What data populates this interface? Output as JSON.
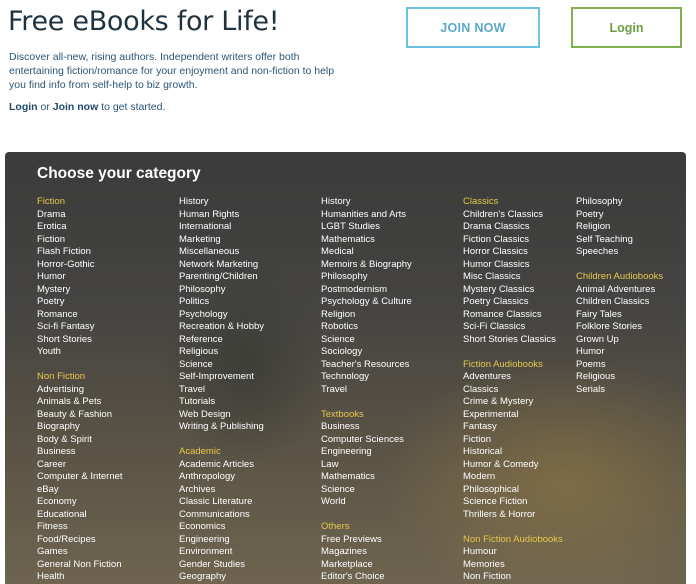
{
  "header": {
    "title": "Free eBooks for Life!",
    "intro": "Discover all-new, rising authors. Independent writers offer both entertaining fiction/romance for your enjoyment and non-fiction to help you find info from self-help to biz growth.",
    "cta_login": "Login",
    "cta_or": " or ",
    "cta_join": "Join now",
    "cta_rest": " to get started.",
    "join_button": "JOIN NOW",
    "login_button": "Login"
  },
  "colors": {
    "join_border": "#6cc0e3",
    "login_border": "#7fb24f",
    "heading_accent": "#e6c84a"
  },
  "categories": {
    "title": "Choose your category",
    "columns": [
      [
        {
          "type": "head",
          "label": "Fiction"
        },
        {
          "type": "item",
          "label": "Drama"
        },
        {
          "type": "item",
          "label": "Erotica"
        },
        {
          "type": "item",
          "label": "Fiction"
        },
        {
          "type": "item",
          "label": "Flash Fiction"
        },
        {
          "type": "item",
          "label": "Horror-Gothic"
        },
        {
          "type": "item",
          "label": "Humor"
        },
        {
          "type": "item",
          "label": "Mystery"
        },
        {
          "type": "item",
          "label": "Poetry"
        },
        {
          "type": "item",
          "label": "Romance"
        },
        {
          "type": "item",
          "label": "Sci-fi Fantasy"
        },
        {
          "type": "item",
          "label": "Short Stories"
        },
        {
          "type": "item",
          "label": "Youth"
        },
        {
          "type": "gap"
        },
        {
          "type": "head",
          "label": "Non Fiction"
        },
        {
          "type": "item",
          "label": "Advertising"
        },
        {
          "type": "item",
          "label": "Animals & Pets"
        },
        {
          "type": "item",
          "label": "Beauty & Fashion"
        },
        {
          "type": "item",
          "label": "Biography"
        },
        {
          "type": "item",
          "label": "Body & Spirit"
        },
        {
          "type": "item",
          "label": "Business"
        },
        {
          "type": "item",
          "label": "Career"
        },
        {
          "type": "item",
          "label": "Computer & Internet"
        },
        {
          "type": "item",
          "label": "eBay"
        },
        {
          "type": "item",
          "label": "Economy"
        },
        {
          "type": "item",
          "label": "Educational"
        },
        {
          "type": "item",
          "label": "Fitness"
        },
        {
          "type": "item",
          "label": "Food/Recipes"
        },
        {
          "type": "item",
          "label": "Games"
        },
        {
          "type": "item",
          "label": "General Non Fiction"
        },
        {
          "type": "item",
          "label": "Health"
        }
      ],
      [
        {
          "type": "item",
          "label": "History"
        },
        {
          "type": "item",
          "label": "Human Rights"
        },
        {
          "type": "item",
          "label": "International"
        },
        {
          "type": "item",
          "label": "Marketing"
        },
        {
          "type": "item",
          "label": "Miscellaneous"
        },
        {
          "type": "item",
          "label": "Network Marketing"
        },
        {
          "type": "item",
          "label": "Parenting/Children"
        },
        {
          "type": "item",
          "label": "Philosophy"
        },
        {
          "type": "item",
          "label": "Politics"
        },
        {
          "type": "item",
          "label": "Psychology"
        },
        {
          "type": "item",
          "label": "Recreation & Hobby"
        },
        {
          "type": "item",
          "label": "Reference"
        },
        {
          "type": "item",
          "label": "Religious"
        },
        {
          "type": "item",
          "label": "Science"
        },
        {
          "type": "item",
          "label": "Self-Improvement"
        },
        {
          "type": "item",
          "label": "Travel"
        },
        {
          "type": "item",
          "label": "Tutorials"
        },
        {
          "type": "item",
          "label": "Web Design"
        },
        {
          "type": "item",
          "label": "Writing & Publishing"
        },
        {
          "type": "gap"
        },
        {
          "type": "head",
          "label": "Academic"
        },
        {
          "type": "item",
          "label": "Academic Articles"
        },
        {
          "type": "item",
          "label": "Anthropology"
        },
        {
          "type": "item",
          "label": "Archives"
        },
        {
          "type": "item",
          "label": "Classic Literature"
        },
        {
          "type": "item",
          "label": "Communications"
        },
        {
          "type": "item",
          "label": "Economics"
        },
        {
          "type": "item",
          "label": "Engineering"
        },
        {
          "type": "item",
          "label": "Environment"
        },
        {
          "type": "item",
          "label": "Gender Studies"
        },
        {
          "type": "item",
          "label": "Geography"
        }
      ],
      [
        {
          "type": "item",
          "label": "History"
        },
        {
          "type": "item",
          "label": "Humanities and Arts"
        },
        {
          "type": "item",
          "label": "LGBT Studies"
        },
        {
          "type": "item",
          "label": "Mathematics"
        },
        {
          "type": "item",
          "label": "Medical"
        },
        {
          "type": "item",
          "label": "Memoirs & Biography"
        },
        {
          "type": "item",
          "label": "Philosophy"
        },
        {
          "type": "item",
          "label": "Postmodernism"
        },
        {
          "type": "item",
          "label": "Psychology & Culture"
        },
        {
          "type": "item",
          "label": "Religion"
        },
        {
          "type": "item",
          "label": "Robotics"
        },
        {
          "type": "item",
          "label": "Science"
        },
        {
          "type": "item",
          "label": "Sociology"
        },
        {
          "type": "item",
          "label": "Teacher's Resources"
        },
        {
          "type": "item",
          "label": "Technology"
        },
        {
          "type": "item",
          "label": "Travel"
        },
        {
          "type": "gap"
        },
        {
          "type": "head",
          "label": "Textbooks"
        },
        {
          "type": "item",
          "label": "Business"
        },
        {
          "type": "item",
          "label": "Computer Sciences"
        },
        {
          "type": "item",
          "label": "Engineering"
        },
        {
          "type": "item",
          "label": "Law"
        },
        {
          "type": "item",
          "label": "Mathematics"
        },
        {
          "type": "item",
          "label": "Science"
        },
        {
          "type": "item",
          "label": "World"
        },
        {
          "type": "gap"
        },
        {
          "type": "head",
          "label": "Others"
        },
        {
          "type": "item",
          "label": "Free Previews"
        },
        {
          "type": "item",
          "label": "Magazines"
        },
        {
          "type": "item",
          "label": "Marketplace"
        },
        {
          "type": "item",
          "label": "Editor's Choice"
        }
      ],
      [
        {
          "type": "head",
          "label": "Classics"
        },
        {
          "type": "item",
          "label": "Children's Classics"
        },
        {
          "type": "item",
          "label": "Drama Classics"
        },
        {
          "type": "item",
          "label": "Fiction Classics"
        },
        {
          "type": "item",
          "label": "Horror Classics"
        },
        {
          "type": "item",
          "label": "Humor Classics"
        },
        {
          "type": "item",
          "label": "Misc Classics"
        },
        {
          "type": "item",
          "label": "Mystery Classics"
        },
        {
          "type": "item",
          "label": "Poetry Classics"
        },
        {
          "type": "item",
          "label": "Romance Classics"
        },
        {
          "type": "item",
          "label": "Sci-Fi Classics"
        },
        {
          "type": "item",
          "label": "Short Stories Classics"
        },
        {
          "type": "gap"
        },
        {
          "type": "head",
          "label": "Fiction Audiobooks"
        },
        {
          "type": "item",
          "label": "Adventures"
        },
        {
          "type": "item",
          "label": "Classics"
        },
        {
          "type": "item",
          "label": "Crime & Mystery"
        },
        {
          "type": "item",
          "label": "Experimental"
        },
        {
          "type": "item",
          "label": "Fantasy"
        },
        {
          "type": "item",
          "label": "Fiction"
        },
        {
          "type": "item",
          "label": "Historical"
        },
        {
          "type": "item",
          "label": "Humor & Comedy"
        },
        {
          "type": "item",
          "label": "Modern"
        },
        {
          "type": "item",
          "label": "Philosophical"
        },
        {
          "type": "item",
          "label": "Science Fiction"
        },
        {
          "type": "item",
          "label": "Thrillers & Horror"
        },
        {
          "type": "gap"
        },
        {
          "type": "head",
          "label": "Non Fiction Audiobooks"
        },
        {
          "type": "item",
          "label": "Humour"
        },
        {
          "type": "item",
          "label": "Memories"
        },
        {
          "type": "item",
          "label": "Non Fiction"
        }
      ],
      [
        {
          "type": "item",
          "label": "Philosophy"
        },
        {
          "type": "item",
          "label": "Poetry"
        },
        {
          "type": "item",
          "label": "Religion"
        },
        {
          "type": "item",
          "label": "Self Teaching"
        },
        {
          "type": "item",
          "label": "Speeches"
        },
        {
          "type": "gap"
        },
        {
          "type": "head",
          "label": "Children Audiobooks"
        },
        {
          "type": "item",
          "label": "Animal Adventures"
        },
        {
          "type": "item",
          "label": "Children Classics"
        },
        {
          "type": "item",
          "label": "Fairy Tales"
        },
        {
          "type": "item",
          "label": "Folklore Stories"
        },
        {
          "type": "item",
          "label": "Grown Up"
        },
        {
          "type": "item",
          "label": "Humor"
        },
        {
          "type": "item",
          "label": "Poems"
        },
        {
          "type": "item",
          "label": "Religious"
        },
        {
          "type": "item",
          "label": "Serials"
        }
      ]
    ]
  }
}
